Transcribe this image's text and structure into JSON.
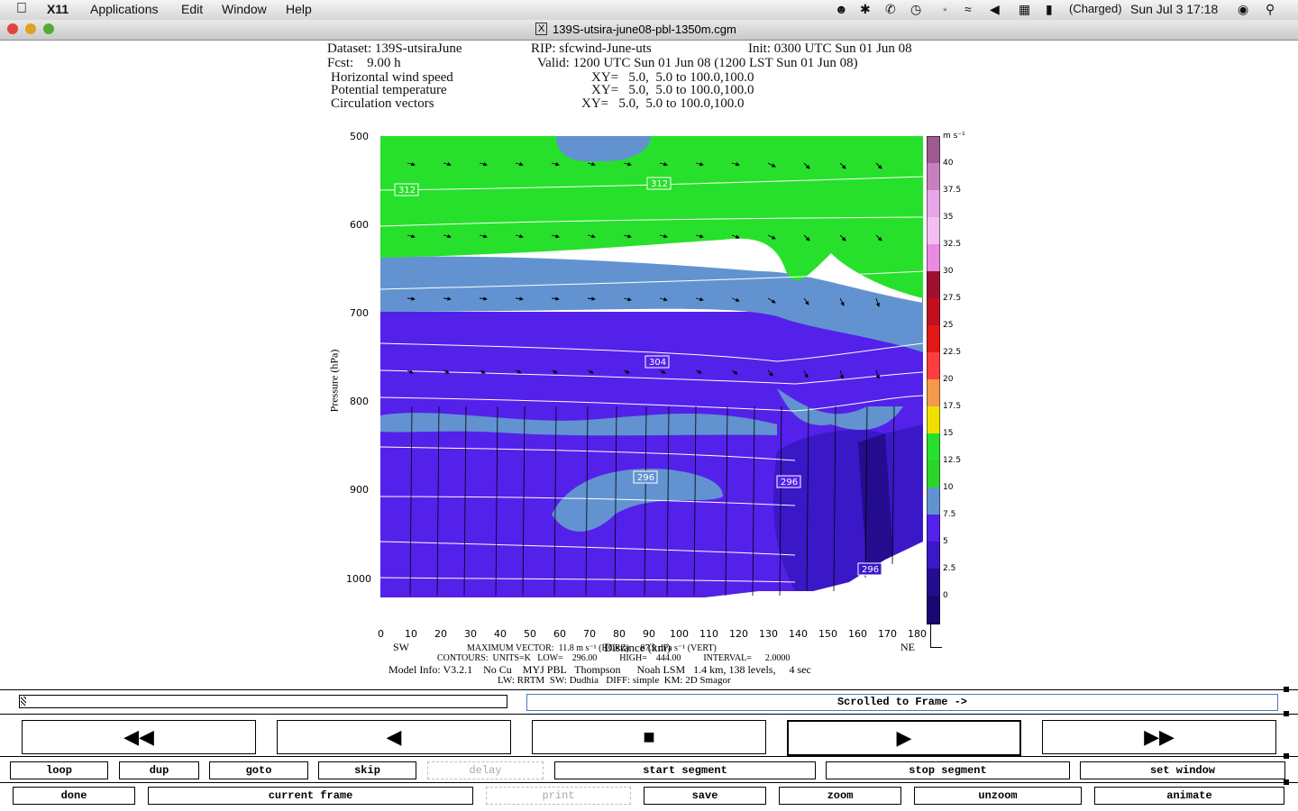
{
  "menubar": {
    "app": "X11",
    "menus": [
      "Applications",
      "Edit",
      "Window",
      "Help"
    ],
    "battery": "(Charged)",
    "clock": "Sun Jul 3  17:18"
  },
  "window": {
    "title": "139S-utsira-june08-pbl-1350m.cgm"
  },
  "header": {
    "line1_left": "Dataset: 139S-utsiraJune",
    "line1_mid": "RIP: sfcwind-June-uts",
    "line1_right": "Init: 0300 UTC Sun 01 Jun 08",
    "line2_left": "Fcst:    9.00 h",
    "line2_right": "Valid: 1200 UTC Sun 01 Jun 08 (1200 LST Sun 01 Jun 08)",
    "fields": [
      {
        "name": "Horizontal wind speed",
        "xy": "XY=   5.0,  5.0 to 100.0,100.0"
      },
      {
        "name": "Potential temperature",
        "xy": "XY=   5.0,  5.0 to 100.0,100.0"
      },
      {
        "name": "Circulation vectors",
        "xy": "XY=   5.0,  5.0 to 100.0,100.0"
      }
    ]
  },
  "plot": {
    "ylabel": "Pressure (hPa)",
    "xlabel": "Distance (km)",
    "yticks": [
      "500",
      "600",
      "700",
      "800",
      "900",
      "1000"
    ],
    "xticks": [
      "0",
      "10",
      "20",
      "30",
      "40",
      "50",
      "60",
      "70",
      "80",
      "90",
      "100",
      "110",
      "120",
      "130",
      "140",
      "150",
      "160",
      "170",
      "180"
    ],
    "left_end": "SW",
    "right_end": "NE",
    "contour_labels": [
      "312",
      "312",
      "304",
      "296",
      "296",
      "296"
    ],
    "colorbar_unit": "m s⁻¹",
    "colorbar_labels": [
      "40",
      "37.5",
      "35",
      "32.5",
      "30",
      "27.5",
      "25",
      "22.5",
      "20",
      "17.5",
      "15",
      "12.5",
      "10",
      "7.5",
      "5",
      "2.5",
      "0"
    ],
    "colorbar_colors": [
      "#9c5a8e",
      "#c77fc0",
      "#e7a6e7",
      "#f2bff0",
      "#e98be0",
      "#c02040",
      "#d01010",
      "#ee1a1a",
      "#ff3d3d",
      "#f49a4a",
      "#f0e000",
      "#21d521",
      "#2bd52b",
      "#6293d0",
      "#4b1eea",
      "#3a18c8",
      "#240c8f",
      "#1a0870"
    ]
  },
  "footer": {
    "max_vector": "MAXIMUM VECTOR:  11.8 m s⁻¹ (HORZ)     87.9 dPa s⁻¹ (VERT)",
    "contours": "CONTOURS:  UNITS=K   LOW=    296.00          HIGH=    444.00          INTERVAL=      2.0000",
    "model_info": "Model Info: V3.2.1    No Cu    MYJ PBL   Thompson      Noah LSM   1.4 km, 138 levels,     4 sec",
    "physics": "LW: RRTM  SW: Dudhia   DIFF: simple  KM: 2D Smagor"
  },
  "status": {
    "scroll_text": "Scrolled to Frame ->"
  },
  "transport": {
    "rewind": "◀◀",
    "back": "◀",
    "stop": "■",
    "play": "▶",
    "forward": "▶▶"
  },
  "buttons_row1": [
    "loop",
    "dup",
    "goto",
    "skip",
    "delay",
    "start segment",
    "stop segment",
    "set window"
  ],
  "buttons_row2": [
    "done",
    "current frame",
    "print",
    "save",
    "zoom",
    "unzoom",
    "animate"
  ],
  "icons": [
    "apple-icon",
    "search-icon",
    "wifi-icon",
    "volume-icon",
    "bluetooth-icon",
    "time-machine-icon",
    "battery-icon",
    "user-icon"
  ]
}
